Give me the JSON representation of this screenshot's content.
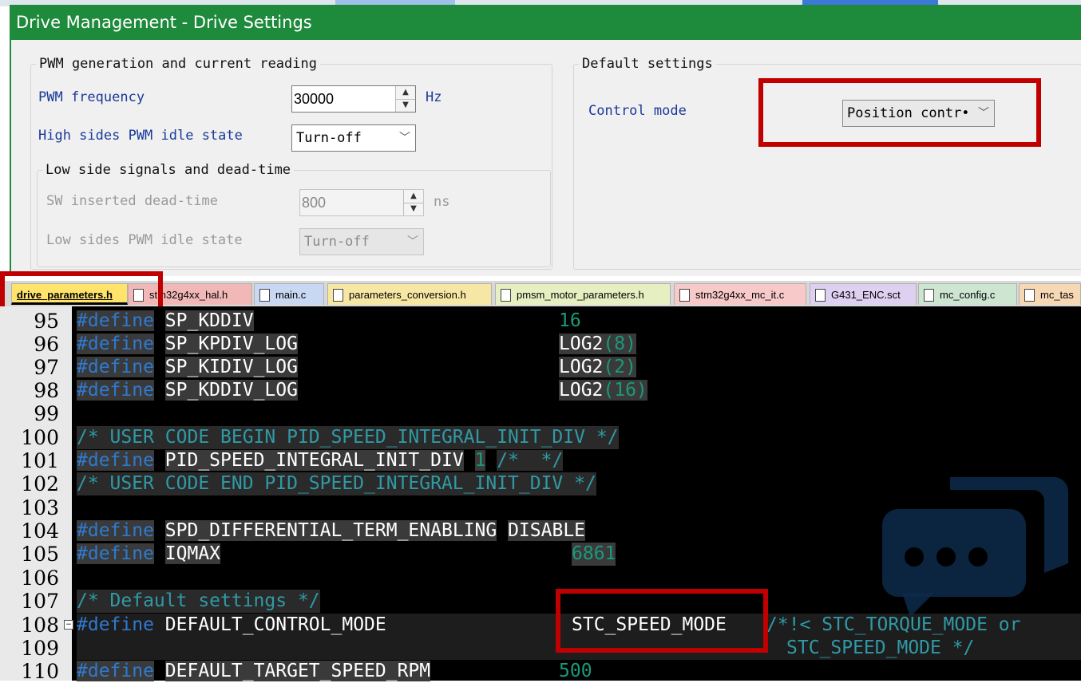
{
  "window": {
    "title": "Drive Management - Drive Settings"
  },
  "pwm_group": {
    "legend": "PWM generation and current reading",
    "freq_label": "PWM frequency",
    "freq_value": "30000",
    "freq_unit": "Hz",
    "idle_label": "High sides PWM idle state",
    "idle_value": "Turn-off",
    "low_side": {
      "legend": "Low side signals and dead-time",
      "deadtime_label": "SW inserted dead-time",
      "deadtime_value": "800",
      "deadtime_unit": "ns",
      "idle_label": "Low sides PWM idle state",
      "idle_value": "Turn-off"
    }
  },
  "default_group": {
    "legend": "Default settings",
    "control_mode_label": "Control mode",
    "control_mode_value": "Position contr•"
  },
  "tabs": [
    {
      "label": "drive_parameters.h",
      "color": "#ffe36a"
    },
    {
      "label": "stm32g4xx_hal.h",
      "color": "#f2b8b8"
    },
    {
      "label": "main.c",
      "color": "#c9d8f2"
    },
    {
      "label": "parameters_conversion.h",
      "color": "#f7e7a4"
    },
    {
      "label": "pmsm_motor_parameters.h",
      "color": "#e6efc2"
    },
    {
      "label": "stm32g4xx_mc_it.c",
      "color": "#f7c9c9"
    },
    {
      "label": "G431_ENC.sct",
      "color": "#ddd0f0"
    },
    {
      "label": "mc_config.c",
      "color": "#cde6d2"
    },
    {
      "label": "mc_tas",
      "color": "#f7d8b5"
    }
  ],
  "code": {
    "line_numbers": [
      "95",
      "96",
      "97",
      "98",
      "99",
      "100",
      "101",
      "102",
      "103",
      "104",
      "105",
      "106",
      "107",
      "108",
      "109",
      "110"
    ],
    "define_kw": "#define",
    "l95_name": "SP_KDDIV",
    "l95_val": "16",
    "l96_name": "SP_KPDIV_LOG",
    "l96_fn": "LOG2",
    "l96_arg": "(8)",
    "l97_name": "SP_KIDIV_LOG",
    "l97_fn": "LOG2",
    "l97_arg": "(2)",
    "l98_name": "SP_KDDIV_LOG",
    "l98_fn": "LOG2",
    "l98_arg": "(16)",
    "l100_comment": "/* USER CODE BEGIN PID_SPEED_INTEGRAL_INIT_DIV */",
    "l101_name": "PID_SPEED_INTEGRAL_INIT_DIV",
    "l101_val": "1",
    "l101_comment": "/*  */",
    "l102_comment": "/* USER CODE END PID_SPEED_INTEGRAL_INIT_DIV */",
    "l104_name": "SPD_DIFFERENTIAL_TERM_ENABLING",
    "l104_val": "DISABLE",
    "l105_name": "IQMAX",
    "l105_val": "6861",
    "l107_comment": "/* Default settings */",
    "l108_name": "DEFAULT_CONTROL_MODE",
    "l108_val": "STC_SPEED_MODE",
    "l108_comment": "/*!< STC_TORQUE_MODE or",
    "l109_comment": "STC_SPEED_MODE */",
    "l110_name": "DEFAULT_TARGET_SPEED_RPM",
    "l110_val": "500"
  },
  "colors": {
    "title_bar": "#1e8a3c",
    "highlight_box": "#c00000",
    "editor_bg": "#000000",
    "keyword": "#2f7ad0",
    "number": "#1a9a7a",
    "comment": "#2f9aa6"
  }
}
